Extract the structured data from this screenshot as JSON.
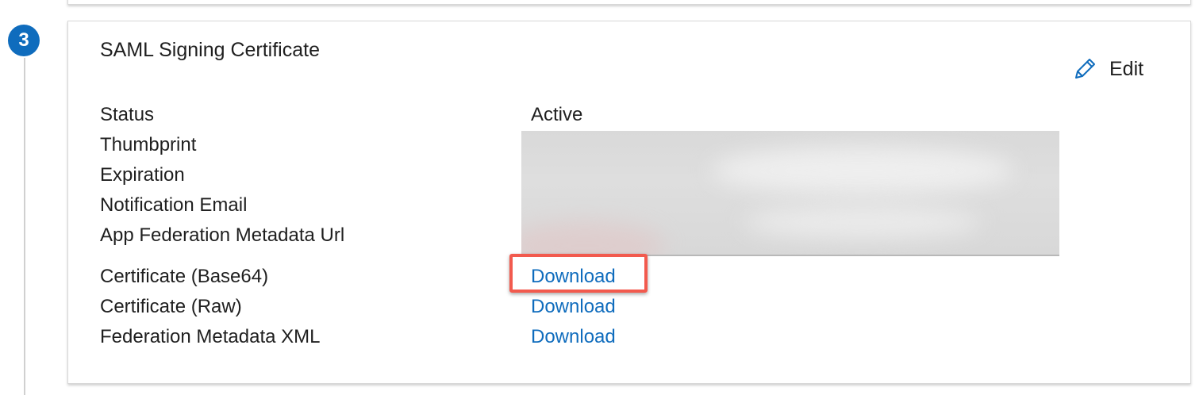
{
  "step": {
    "number": "3"
  },
  "card": {
    "title": "SAML Signing Certificate",
    "edit_label": "Edit",
    "fields": [
      {
        "label": "Status",
        "value": "Active"
      },
      {
        "label": "Thumbprint"
      },
      {
        "label": "Expiration"
      },
      {
        "label": "Notification Email"
      },
      {
        "label": "App Federation Metadata Url"
      }
    ],
    "downloads": [
      {
        "label": "Certificate (Base64)",
        "link": "Download"
      },
      {
        "label": "Certificate (Raw)",
        "link": "Download"
      },
      {
        "label": "Federation Metadata XML",
        "link": "Download"
      }
    ]
  },
  "colors": {
    "accent": "#0f6cbd",
    "highlight": "#f25a4e"
  },
  "icons": {
    "step_badge": "number-3-badge",
    "edit": "pencil-icon"
  }
}
